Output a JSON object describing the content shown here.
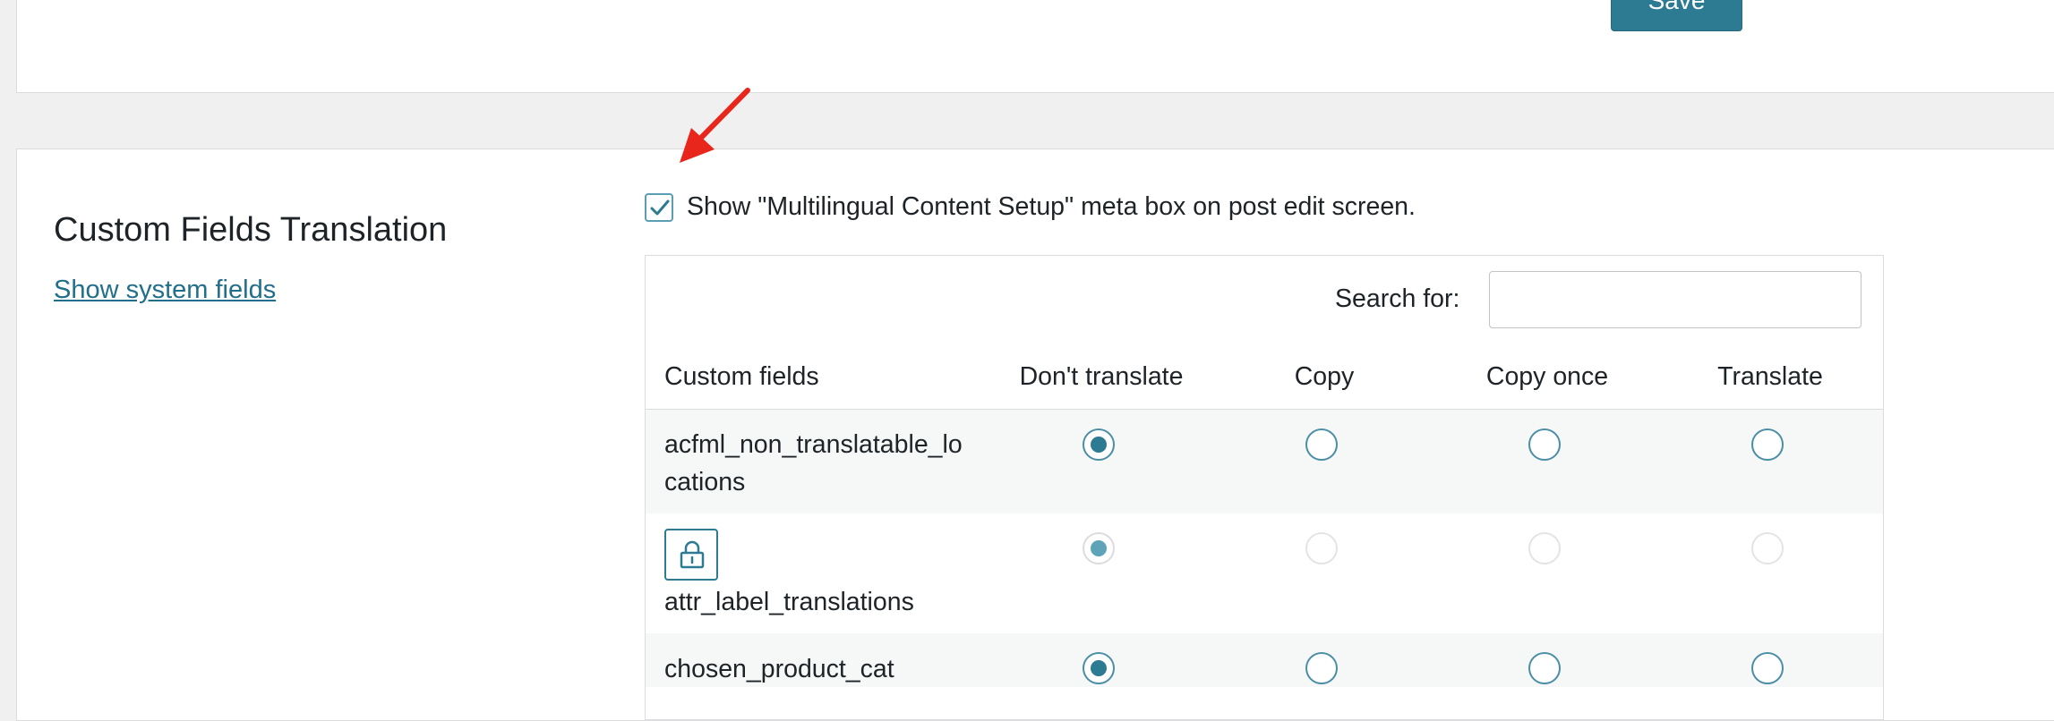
{
  "toolbar": {
    "save_label": "Save"
  },
  "section": {
    "title": "Custom Fields Translation",
    "system_fields_link": "Show system fields"
  },
  "meta_box": {
    "checked": true,
    "label": "Show \"Multilingual Content Setup\" meta box on post edit screen."
  },
  "search": {
    "label": "Search for:",
    "value": "",
    "placeholder": ""
  },
  "table": {
    "headers": {
      "field": "Custom fields",
      "dont_translate": "Don't translate",
      "copy": "Copy",
      "copy_once": "Copy once",
      "translate": "Translate"
    },
    "rows": [
      {
        "name_line1": "acfml_non_translatable_lo",
        "name_line2": "cations",
        "locked": false,
        "selected": "dont_translate"
      },
      {
        "name": "attr_label_translations",
        "locked": true,
        "selected": "dont_translate"
      },
      {
        "name": "chosen_product_cat",
        "locked": false,
        "selected": "dont_translate"
      }
    ]
  },
  "colors": {
    "accent": "#2d7a93",
    "link": "#216f8a",
    "annotation_arrow": "#e8261c",
    "row_stripe": "#f6f7f7"
  },
  "icons": {
    "lock": "lock-icon",
    "checkmark": "checkmark-icon",
    "arrow": "red-arrow-annotation"
  }
}
